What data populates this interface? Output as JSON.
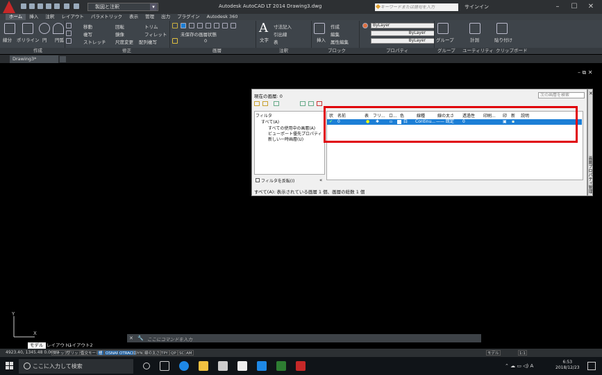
{
  "title_bar": {
    "app_title": "Autodesk AutoCAD LT 2014   Drawing3.dwg",
    "workspace": "製図と注釈",
    "search_placeholder": "キーワードまたは語句を入力",
    "signin": "サインイン"
  },
  "ribbon_tabs": [
    "ホーム",
    "挿入",
    "注釈",
    "レイアウト",
    "パラメトリック",
    "表示",
    "管理",
    "出力",
    "プラグイン",
    "Autodesk 360"
  ],
  "ribbon": {
    "draw_tools": [
      "線分",
      "ポリライン",
      "円",
      "円弧"
    ],
    "modify_tools": [
      "移動",
      "回転",
      "トリム",
      "複写",
      "鏡像",
      "フィレット",
      "ストレッチ",
      "尺度変更",
      "配列複写"
    ],
    "layer_state": "未保存の画層状態",
    "layer_current": "0",
    "annotation_tools": [
      "文字",
      "寸法記入",
      "引出線",
      "表"
    ],
    "block_tools": [
      "挿入",
      "作成",
      "編集",
      "属性編集"
    ],
    "property_values": [
      "ByLayer",
      "ByLayer",
      "ByLayer"
    ],
    "group_label": "グループ",
    "utility_label": "計測",
    "paste_label": "貼り付け",
    "panel_labels": [
      "作成",
      "修正",
      "画層",
      "注釈",
      "ブロック",
      "プロパティ",
      "グループ",
      "ユーティリティ",
      "クリップボード"
    ]
  },
  "file_tab": "Drawing3*",
  "layer_palette": {
    "current_layer": "現在の画層: 0",
    "search_placeholder": "次の画層を検索",
    "filter_header": "フィルタ",
    "filters": [
      "すべて(A)",
      "すべての使用中の画層(A)",
      "ビューポート優先プロパティ",
      "新しい一時画層(U)"
    ],
    "invert_filter": "フィルタを反転(I)",
    "columns": [
      "状",
      "名前",
      "表",
      "フリ...",
      "ロ...",
      "色",
      "線種",
      "線の太さ",
      "透過性",
      "印刷...",
      "印",
      "新",
      "説明"
    ],
    "row": {
      "name": "0",
      "color": "白",
      "linetype": "Continu...",
      "lineweight": "—— 既定",
      "transparency": "0"
    },
    "status": "すべて(A): 表示されている画層 1 個、画層の総数 1 個",
    "side_label": "画層プロパティ管理"
  },
  "command": {
    "placeholder": "ここにコマンドを入力"
  },
  "layout_tabs": [
    "モデル",
    "レイアウト1",
    "レイアウト2"
  ],
  "status_bar": {
    "coords": "4923.40, 1345.48  0.0000",
    "buttons": [
      "スナップ",
      "グリッド",
      "直交モード",
      "極",
      "OSNAP",
      "OTRACK",
      "DYN",
      "線の太さ",
      "TPY",
      "QP",
      "SC",
      "AM"
    ],
    "right": [
      "モデル",
      "1:1"
    ]
  },
  "taskbar": {
    "search": "ここに入力して検索",
    "time": "6:53",
    "date": "2018/12/23",
    "tray_text": "A"
  },
  "colors": {
    "accent": "#1c7fd6",
    "highlight": "#e0000a",
    "ribbon": "#3e444a"
  }
}
